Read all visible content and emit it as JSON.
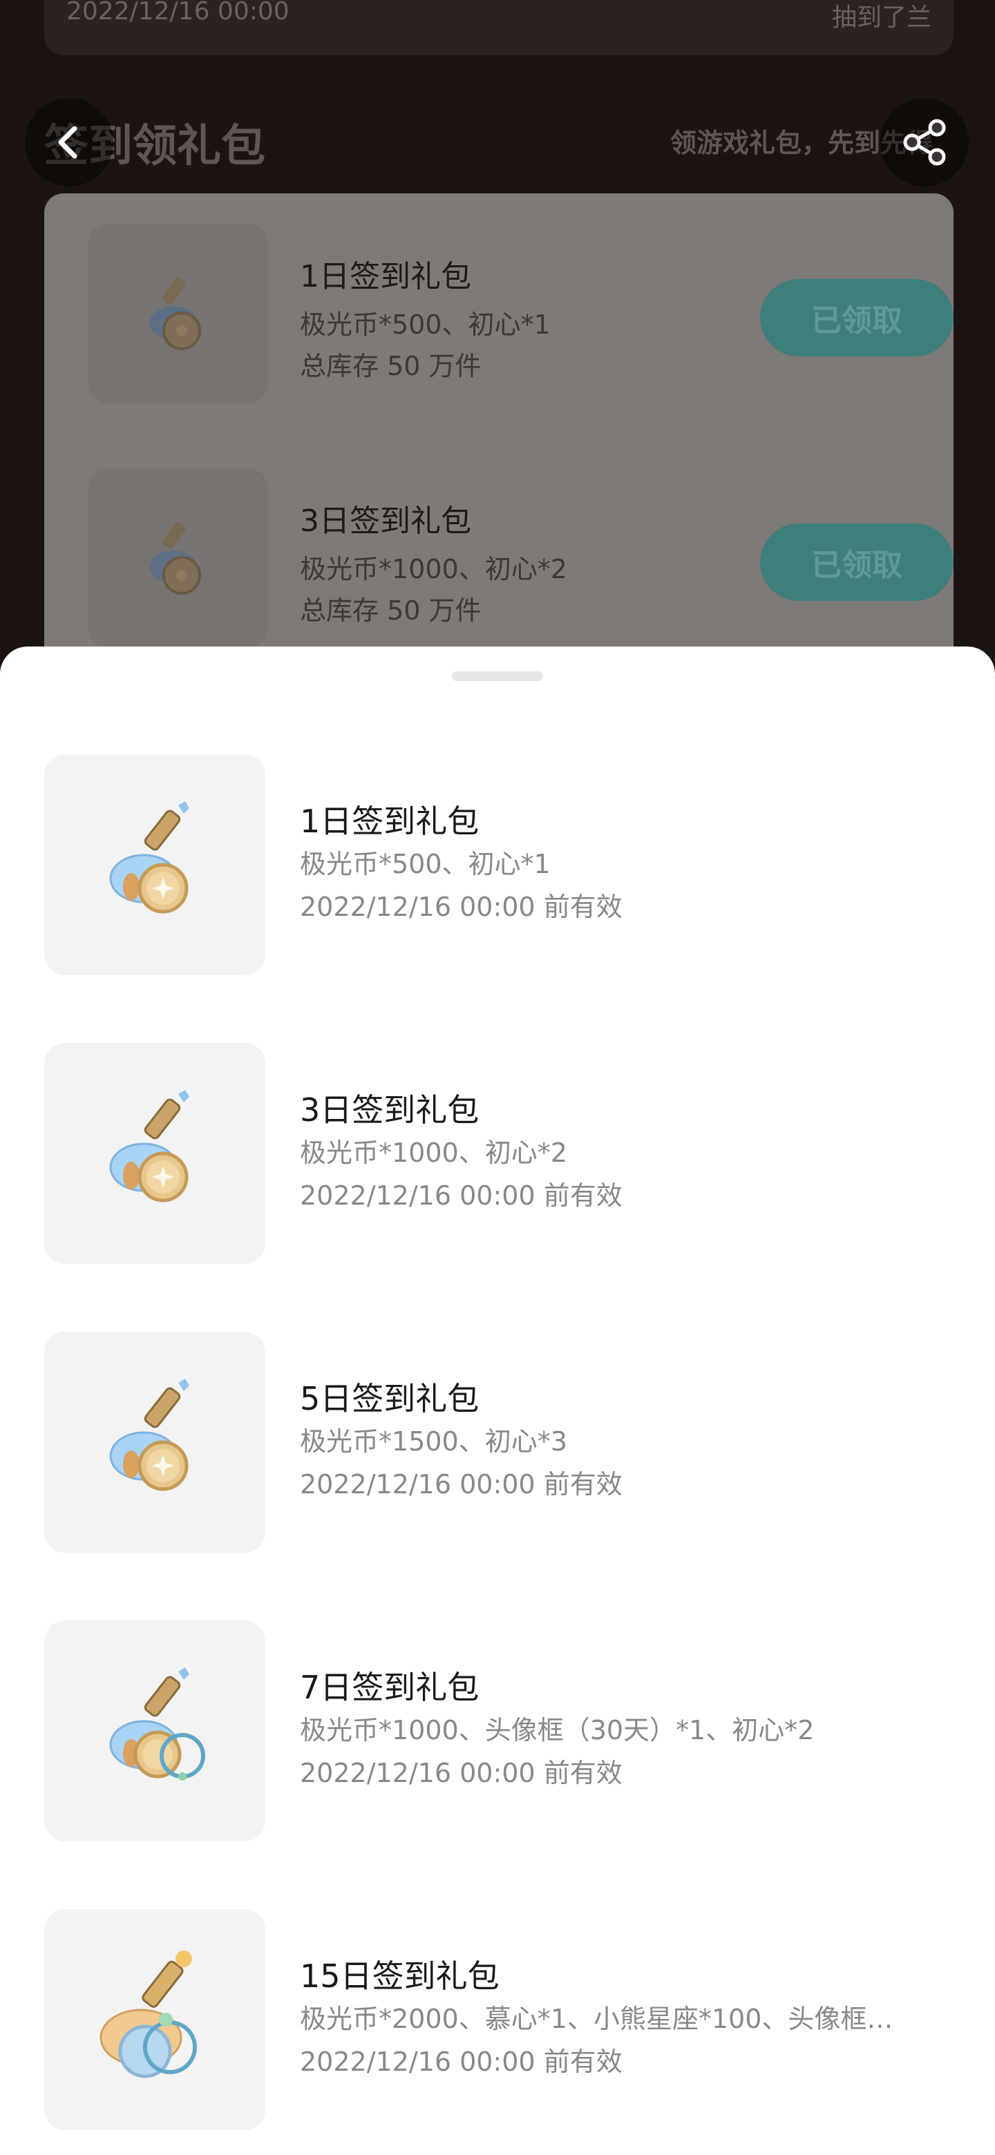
{
  "background": {
    "top_strip": {
      "left": "2022/12/16 00:00",
      "right": "抽到了兰"
    },
    "title": "签到领礼包",
    "subtitle": "领游戏礼包，先到先得",
    "items": [
      {
        "name": "1日签到礼包",
        "desc": "极光币*500、初心*1",
        "stock": "总库存 50 万件",
        "button": "已领取"
      },
      {
        "name": "3日签到礼包",
        "desc": "极光币*1000、初心*2",
        "stock": "总库存 50 万件",
        "button": "已领取"
      }
    ]
  },
  "sheet": {
    "items": [
      {
        "name": "1日签到礼包",
        "desc": "极光币*500、初心*1",
        "expiry": "2022/12/16 00:00 前有效"
      },
      {
        "name": "3日签到礼包",
        "desc": "极光币*1000、初心*2",
        "expiry": "2022/12/16 00:00 前有效"
      },
      {
        "name": "5日签到礼包",
        "desc": "极光币*1500、初心*3",
        "expiry": "2022/12/16 00:00 前有效"
      },
      {
        "name": "7日签到礼包",
        "desc": "极光币*1000、头像框（30天）*1、初心*2",
        "expiry": "2022/12/16 00:00 前有效"
      },
      {
        "name": "15日签到礼包",
        "desc": "极光币*2000、慕心*1、小熊星座*100、头像框…",
        "expiry": "2022/12/16 00:00 前有效"
      }
    ]
  },
  "icons": [
    "back-arrow-icon",
    "share-icon",
    "gift-bottle-icon"
  ],
  "colors": {
    "claimed_button": "#3f7f7c",
    "sheet_bg": "#ffffff",
    "thumb_bg": "#f3f3f3"
  }
}
